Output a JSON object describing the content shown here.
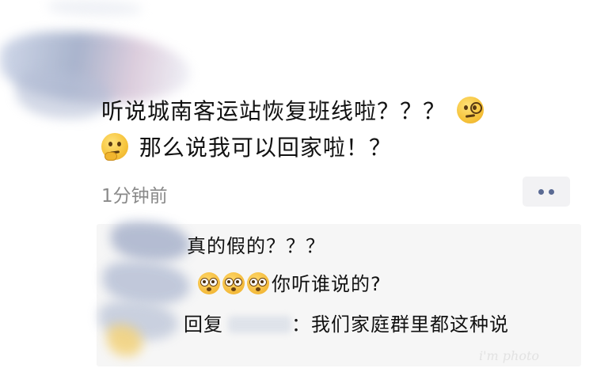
{
  "post": {
    "text_line1": "听说城南客运站恢复班线啦？？？",
    "text_line2": "那么说我可以回家啦！？",
    "emoji_1": "face-with-monocle-icon",
    "emoji_2": "thinking-face-icon",
    "time": "1分钟前"
  },
  "comments": [
    {
      "text": "真的假的？？？"
    },
    {
      "emoji": "flushed-face-icon",
      "emoji_count": 3,
      "text": "你听谁说的?"
    },
    {
      "reply_label": "回复",
      "text": "我们家庭群里都这种说"
    }
  ],
  "watermark": "i'm photo",
  "colors": {
    "text": "#111111",
    "time": "#8a8a8a",
    "comment_bg": "#f6f6f6",
    "more_dots": "#5a6a93"
  }
}
